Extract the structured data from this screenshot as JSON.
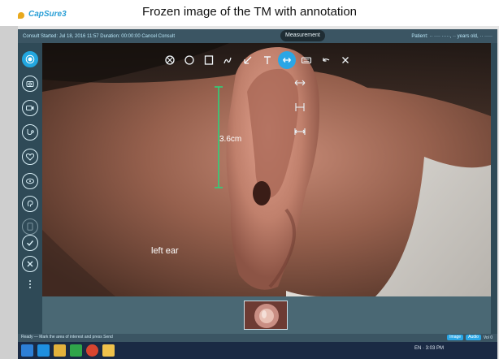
{
  "slide": {
    "title": "Frozen image of the TM with annotation",
    "brand_name": "CapSure3"
  },
  "header": {
    "left_text": "Consult Started: Jul 18, 2016 11:57   Duration: 00:00:00   Cancel Consult",
    "right_text": "Patient: ·· ···· ·····, ·· years old, ·· ·····"
  },
  "toolbar": {
    "tooltip": "Measurement",
    "tools": [
      {
        "name": "circle-slash-tool-icon"
      },
      {
        "name": "ellipse-tool-icon"
      },
      {
        "name": "rectangle-tool-icon"
      },
      {
        "name": "freehand-tool-icon"
      },
      {
        "name": "arrow-tool-icon"
      },
      {
        "name": "text-tool-icon"
      },
      {
        "name": "measure-tool-icon",
        "active": true
      },
      {
        "name": "keyboard-tool-icon"
      },
      {
        "name": "undo-icon"
      },
      {
        "name": "close-icon"
      }
    ]
  },
  "annotations": {
    "measurement": "3.6cm",
    "ear_label": "left ear"
  },
  "status": {
    "text": "Ready — Mark the area of interest and press Send",
    "btn_a": "Image",
    "btn_b": "Audio",
    "right": "Vol 0"
  },
  "taskbar": {
    "tray": "EN  ·  3:03 PM"
  },
  "colors": {
    "accent": "#2aa6e5",
    "chrome": "#3b5563",
    "sidebar": "#2f4a57",
    "measure": "#2fd07a"
  }
}
